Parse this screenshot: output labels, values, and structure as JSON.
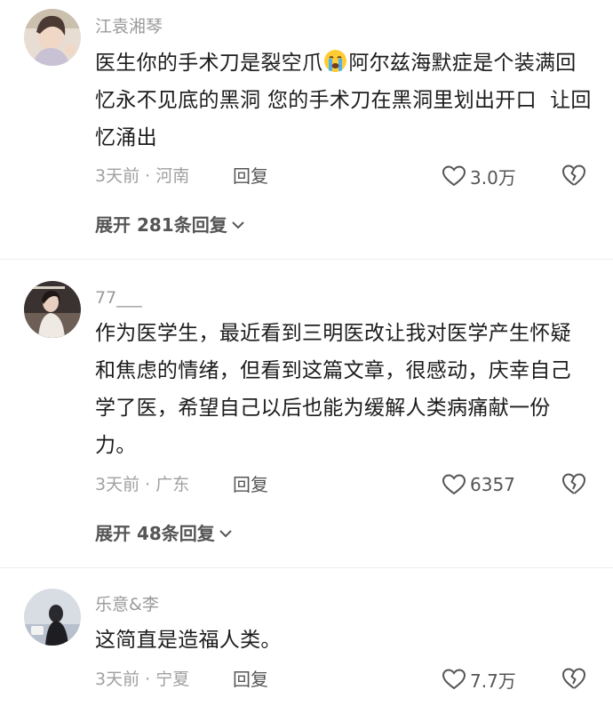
{
  "comments": [
    {
      "username": "江袁湘琴",
      "text_before_emoji": "医生你的手术刀是裂空爪",
      "emoji": "crying-face-emoji",
      "text_after_emoji": "阿尔兹海默症是个装满回忆永不见底的黑洞 您的手术刀在黑洞里划出开口  让回忆涌出",
      "time": "3天前",
      "location": "河南",
      "reply_label": "回复",
      "likes": "3.0万",
      "expand_label": "展开 281条回复"
    },
    {
      "username": "77___",
      "text": "作为医学生，最近看到三明医改让我对医学产生怀疑和焦虑的情绪，但看到这篇文章，很感动，庆幸自己学了医，希望自己以后也能为缓解人类病痛献一份力。",
      "time": "3天前",
      "location": "广东",
      "reply_label": "回复",
      "likes": "6357",
      "expand_label": "展开 48条回复"
    },
    {
      "username": "乐意&李",
      "text": "这简直是造福人类。",
      "time": "3天前",
      "location": "宁夏",
      "reply_label": "回复",
      "likes": "7.7万"
    }
  ],
  "meta_separator": " · ",
  "icons": {
    "like": "heart-outline-icon",
    "dislike": "broken-heart-icon",
    "expand": "chevron-down-icon"
  },
  "colors": {
    "text": "#1c1c1c",
    "meta": "#a0a0a0",
    "action": "#555555"
  }
}
